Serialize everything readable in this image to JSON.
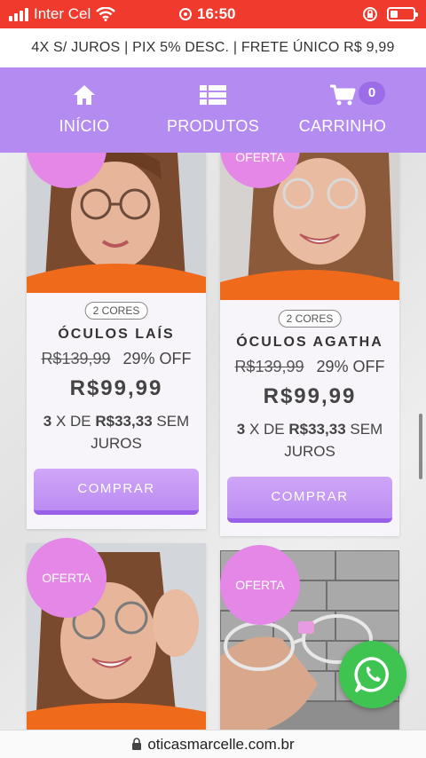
{
  "status_bar": {
    "carrier": "Inter Cel",
    "time": "16:50"
  },
  "promo": {
    "text": "4X S/ JUROS | PIX 5% DESC. | FRETE ÚNICO R$ 9,99"
  },
  "nav": {
    "items": [
      {
        "label": "INÍCIO",
        "icon": "home-icon"
      },
      {
        "label": "PRODUTOS",
        "icon": "list-icon"
      },
      {
        "label": "CARRINHO",
        "icon": "cart-icon"
      }
    ],
    "cart_count": "0"
  },
  "products": [
    {
      "badge": "",
      "colors": "2 CORES",
      "name": "ÓCULOS LAÍS",
      "old_price": "R$139,99",
      "discount": "29% OFF",
      "price": "R$99,99",
      "installments_count": "3",
      "installments_mid": " X DE ",
      "installments_value": "R$33,33",
      "installments_suffix": " SEM JUROS",
      "button": "COMPRAR"
    },
    {
      "badge": "OFERTA",
      "colors": "2 CORES",
      "name": "ÓCULOS AGATHA",
      "old_price": "R$139,99",
      "discount": "29% OFF",
      "price": "R$99,99",
      "installments_count": "3",
      "installments_mid": " X DE ",
      "installments_value": "R$33,33",
      "installments_suffix": " SEM JUROS",
      "button": "COMPRAR"
    },
    {
      "badge": "OFERTA"
    },
    {
      "badge": "OFERTA"
    }
  ],
  "url": {
    "domain": "oticasmarcelle.com.br"
  },
  "colors": {
    "status_bar": "#f03a2e",
    "nav": "#b48bf0",
    "badge": "#e487e6",
    "button": "#bb8cf2",
    "whatsapp": "#3fc351"
  }
}
